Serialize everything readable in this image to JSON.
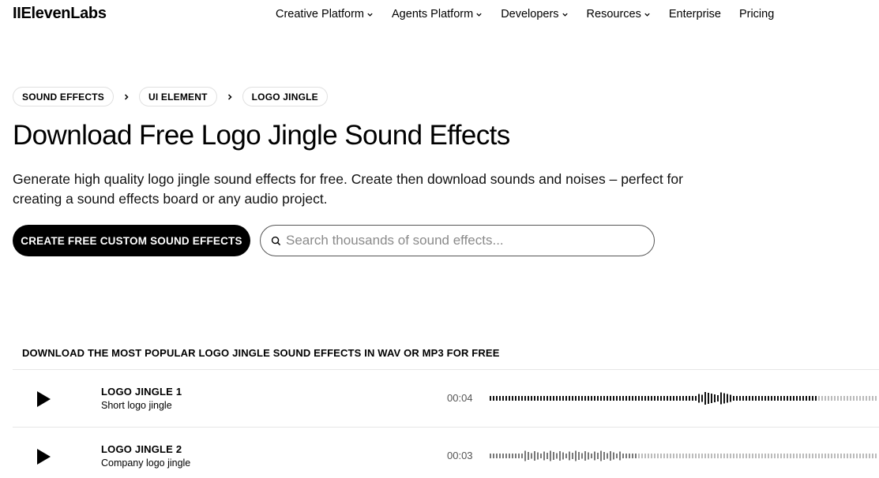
{
  "header": {
    "logo": "IIElevenLabs",
    "nav": [
      {
        "label": "Creative Platform",
        "has_dropdown": true,
        "icon": "chevron-down-icon"
      },
      {
        "label": "Agents Platform",
        "has_dropdown": true,
        "icon": "chevron-down-icon"
      },
      {
        "label": "Developers",
        "has_dropdown": true,
        "icon": "chevron-down-icon"
      },
      {
        "label": "Resources",
        "has_dropdown": true,
        "icon": "chevron-down-icon"
      },
      {
        "label": "Enterprise",
        "has_dropdown": false
      },
      {
        "label": "Pricing",
        "has_dropdown": false
      }
    ]
  },
  "breadcrumb": [
    "SOUND EFFECTS",
    "UI ELEMENT",
    "LOGO JINGLE"
  ],
  "page": {
    "title": "Download Free Logo Jingle Sound Effects",
    "subtitle": "Generate high quality logo jingle sound effects for free. Create then download sounds and noises – perfect for creating a sound effects board or any audio project."
  },
  "cta": {
    "label": "CREATE FREE CUSTOM SOUND EFFECTS"
  },
  "search": {
    "placeholder": "Search thousands of sound effects...",
    "value": "",
    "icon": "search-icon"
  },
  "list": {
    "heading": "DOWNLOAD THE MOST POPULAR LOGO JINGLE SOUND EFFECTS IN WAV OR MP3 FOR FREE",
    "items": [
      {
        "name": "LOGO JINGLE 1",
        "description": "Short logo jingle",
        "duration": "00:04",
        "play_icon": "play-icon"
      },
      {
        "name": "LOGO JINGLE 2",
        "description": "Company logo jingle",
        "duration": "00:03",
        "play_icon": "play-icon"
      }
    ]
  },
  "colors": {
    "primary": "#000000",
    "background": "#ffffff",
    "muted_text": "#555555",
    "border": "#e0e0e0",
    "placeholder": "#8a8a8a"
  }
}
